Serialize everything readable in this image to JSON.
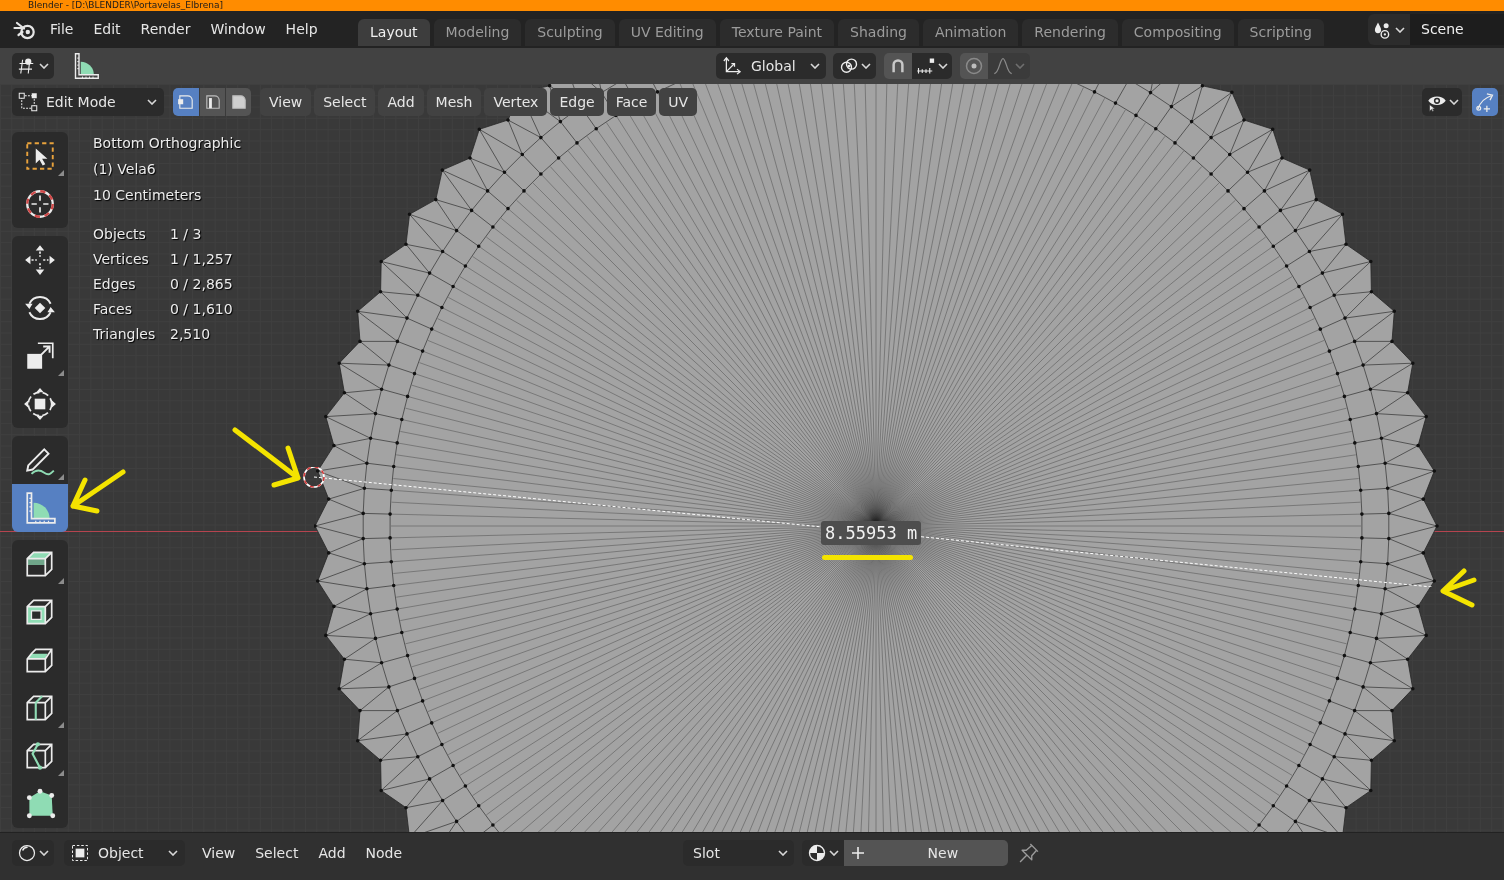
{
  "title_bar": {
    "title": "Blender - [D:\\BLENDER\\Portavelas_Elbrena]"
  },
  "menu_bar": {
    "items": [
      "File",
      "Edit",
      "Render",
      "Window",
      "Help"
    ]
  },
  "workspace_tabs": [
    {
      "label": "Layout",
      "selected": true
    },
    {
      "label": "Modeling",
      "selected": false
    },
    {
      "label": "Sculpting",
      "selected": false
    },
    {
      "label": "UV Editing",
      "selected": false
    },
    {
      "label": "Texture Paint",
      "selected": false
    },
    {
      "label": "Shading",
      "selected": false
    },
    {
      "label": "Animation",
      "selected": false
    },
    {
      "label": "Rendering",
      "selected": false
    },
    {
      "label": "Compositing",
      "selected": false
    },
    {
      "label": "Scripting",
      "selected": false
    }
  ],
  "scene": {
    "name": "Scene"
  },
  "tool_settings": {
    "orientation": "Global"
  },
  "viewport_header": {
    "mode": "Edit Mode",
    "select_modes": [
      {
        "kind": "vertex",
        "selected": true
      },
      {
        "kind": "edge",
        "selected": false
      },
      {
        "kind": "face",
        "selected": false
      }
    ],
    "menus": [
      "View",
      "Select",
      "Add",
      "Mesh",
      "Vertex",
      "Edge",
      "Face",
      "UV"
    ],
    "gizmos_on": true
  },
  "toolbar": {
    "groups": [
      {
        "tools": [
          {
            "kind": "select_box",
            "selected": false,
            "submenu": true
          },
          {
            "kind": "cursor",
            "selected": false,
            "submenu": false
          }
        ]
      },
      {
        "tools": [
          {
            "kind": "move",
            "selected": false,
            "submenu": false
          },
          {
            "kind": "rotate",
            "selected": false,
            "submenu": false
          },
          {
            "kind": "scale",
            "selected": false,
            "submenu": true
          },
          {
            "kind": "transform",
            "selected": false,
            "submenu": false
          }
        ]
      },
      {
        "tools": [
          {
            "kind": "annotate",
            "selected": false,
            "submenu": true
          },
          {
            "kind": "measure",
            "selected": true,
            "submenu": false
          }
        ]
      },
      {
        "tools": [
          {
            "kind": "extrude",
            "selected": false,
            "submenu": true
          },
          {
            "kind": "inset",
            "selected": false,
            "submenu": false
          },
          {
            "kind": "bevel",
            "selected": false,
            "submenu": false
          },
          {
            "kind": "loop_cut",
            "selected": false,
            "submenu": true
          },
          {
            "kind": "knife",
            "selected": false,
            "submenu": true
          },
          {
            "kind": "poly_build",
            "selected": false,
            "submenu": false
          }
        ]
      }
    ]
  },
  "viewport_info": {
    "view": "Bottom Orthographic",
    "object": "(1) Vela6",
    "grid_scale": "10 Centimeters",
    "stats": [
      {
        "label": "Objects",
        "value": "1 / 3"
      },
      {
        "label": "Vertices",
        "value": "1 / 1,257"
      },
      {
        "label": "Edges",
        "value": "0 / 2,865"
      },
      {
        "label": "Faces",
        "value": "0 / 1,610"
      },
      {
        "label": "Triangles",
        "value": "2,510"
      }
    ]
  },
  "measurement": {
    "reading": "8.55953 m"
  },
  "bottom_bar": {
    "mode": "Object",
    "menus": [
      "View",
      "Select",
      "Add",
      "Node"
    ],
    "slot": "Slot",
    "new_button": "New"
  }
}
